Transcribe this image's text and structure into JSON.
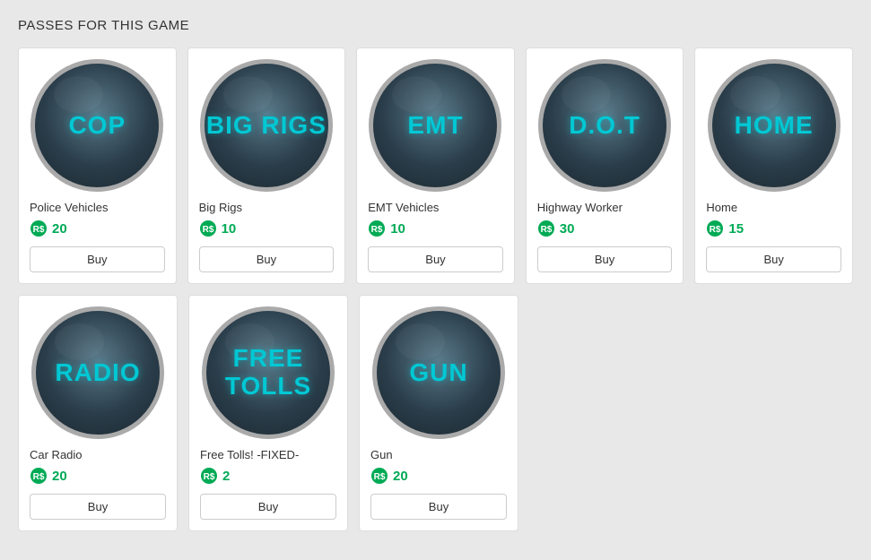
{
  "page": {
    "title": "PASSES FOR THIS GAME"
  },
  "passes": [
    {
      "id": "cop",
      "icon_text": "COP",
      "name": "Police Vehicles",
      "price": 20,
      "buy_label": "Buy"
    },
    {
      "id": "big-rigs",
      "icon_text": "BIG RIGS",
      "name": "Big Rigs",
      "price": 10,
      "buy_label": "Buy"
    },
    {
      "id": "emt",
      "icon_text": "EMT",
      "name": "EMT Vehicles",
      "price": 10,
      "buy_label": "Buy"
    },
    {
      "id": "dot",
      "icon_text": "D.O.T",
      "name": "Highway Worker",
      "price": 30,
      "buy_label": "Buy"
    },
    {
      "id": "home",
      "icon_text": "HOME",
      "name": "Home",
      "price": 15,
      "buy_label": "Buy"
    },
    {
      "id": "radio",
      "icon_text": "RADIO",
      "name": "Car Radio",
      "price": 20,
      "buy_label": "Buy"
    },
    {
      "id": "free-tolls",
      "icon_text": "FREE TOLLS",
      "name": "Free Tolls! -FIXED-",
      "price": 2,
      "buy_label": "Buy"
    },
    {
      "id": "gun",
      "icon_text": "GUN",
      "name": "Gun",
      "price": 20,
      "buy_label": "Buy"
    }
  ]
}
